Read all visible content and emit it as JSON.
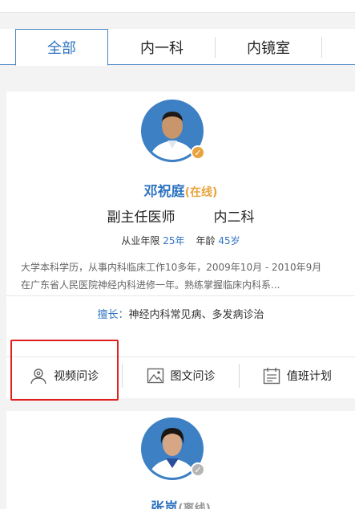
{
  "tabs": [
    {
      "label": "全部",
      "active": true
    },
    {
      "label": "内一科",
      "active": false
    },
    {
      "label": "内镜室",
      "active": false
    }
  ],
  "doctors": [
    {
      "name": "邓祝庭",
      "status": "(在线)",
      "status_color": "#e8a33d",
      "title": "副主任医师",
      "department": "内二科",
      "years_label": "从业年限",
      "years_value": "25年",
      "age_label": "年龄",
      "age_value": "45岁",
      "description": "大学本科学历，从事内科临床工作10多年，2009年10月 - 2010年9月在广东省人民医院神经内科进修一年。熟练掌握临床内科系...",
      "specialty_label": "擅长：",
      "specialty": "神经内科常见病、多发病诊治",
      "badge_icon": "check-badge-icon"
    },
    {
      "name": "张岚",
      "status": "(离线)",
      "status_color": "#999999",
      "badge_icon": "check-badge-icon"
    }
  ],
  "actions": [
    {
      "label": "视频问诊",
      "icon": "person-icon"
    },
    {
      "label": "图文问诊",
      "icon": "image-icon"
    },
    {
      "label": "值班计划",
      "icon": "calendar-icon"
    }
  ],
  "colors": {
    "accent": "#2f74c0",
    "online": "#e8a33d",
    "highlight": "#e0201c"
  }
}
